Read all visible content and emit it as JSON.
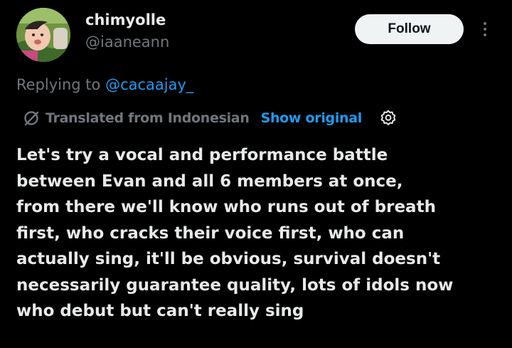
{
  "author": {
    "display_name": "chimyolle",
    "handle": "@iaaneann"
  },
  "actions": {
    "follow_label": "Follow",
    "more_icon": "more-vertical-icon"
  },
  "reply_context": {
    "prefix": "Replying to ",
    "mention": "@cacaajay_"
  },
  "translation": {
    "icon": "translate-icon",
    "label": "Translated from Indonesian",
    "show_original": "Show original",
    "settings_icon": "gear-icon"
  },
  "tweet": {
    "lines": [
      "Let's try a vocal and performance battle",
      "between Evan and all 6 members at once,",
      "from there we'll know who runs out of breath",
      "first, who cracks their voice first, who can",
      "actually sing, it'll be obvious, survival doesn't",
      "necessarily guarantee quality, lots of idols now",
      "who debut but can't really sing"
    ]
  },
  "colors": {
    "background": "#000000",
    "primary_text": "#e7e9ea",
    "secondary_text": "#71767b",
    "link": "#1d9bf0",
    "follow_bg": "#eff3f4"
  }
}
